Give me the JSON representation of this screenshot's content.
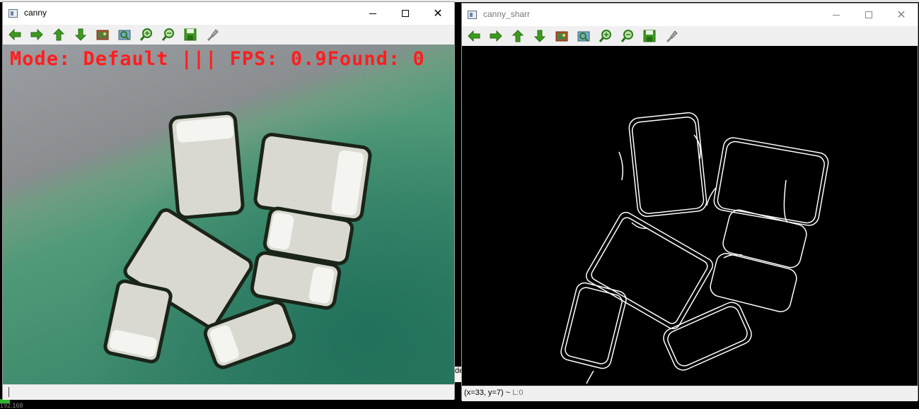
{
  "windows": {
    "left": {
      "title": "canny",
      "overlay_text": "Mode: Default ||| FPS: 0.9Found: 0",
      "status_text": ""
    },
    "right": {
      "title": "canny_sharr",
      "status_coords": "(x=33, y=7) ~",
      "status_extra": "L:0"
    }
  },
  "toolbar_icons": [
    "pan-left-icon",
    "pan-right-icon",
    "pan-up-icon",
    "pan-down-icon",
    "zoom-reset-icon",
    "zoom-fit-icon",
    "zoom-in-icon",
    "zoom-out-icon",
    "save-icon",
    "properties-icon"
  ],
  "colors": {
    "overlay_red": "#ff1e1e",
    "arrow_green": "#3d9a1f",
    "edge_white": "#ffffff"
  },
  "background_fragment_text": "de",
  "corner_text": "192.168"
}
